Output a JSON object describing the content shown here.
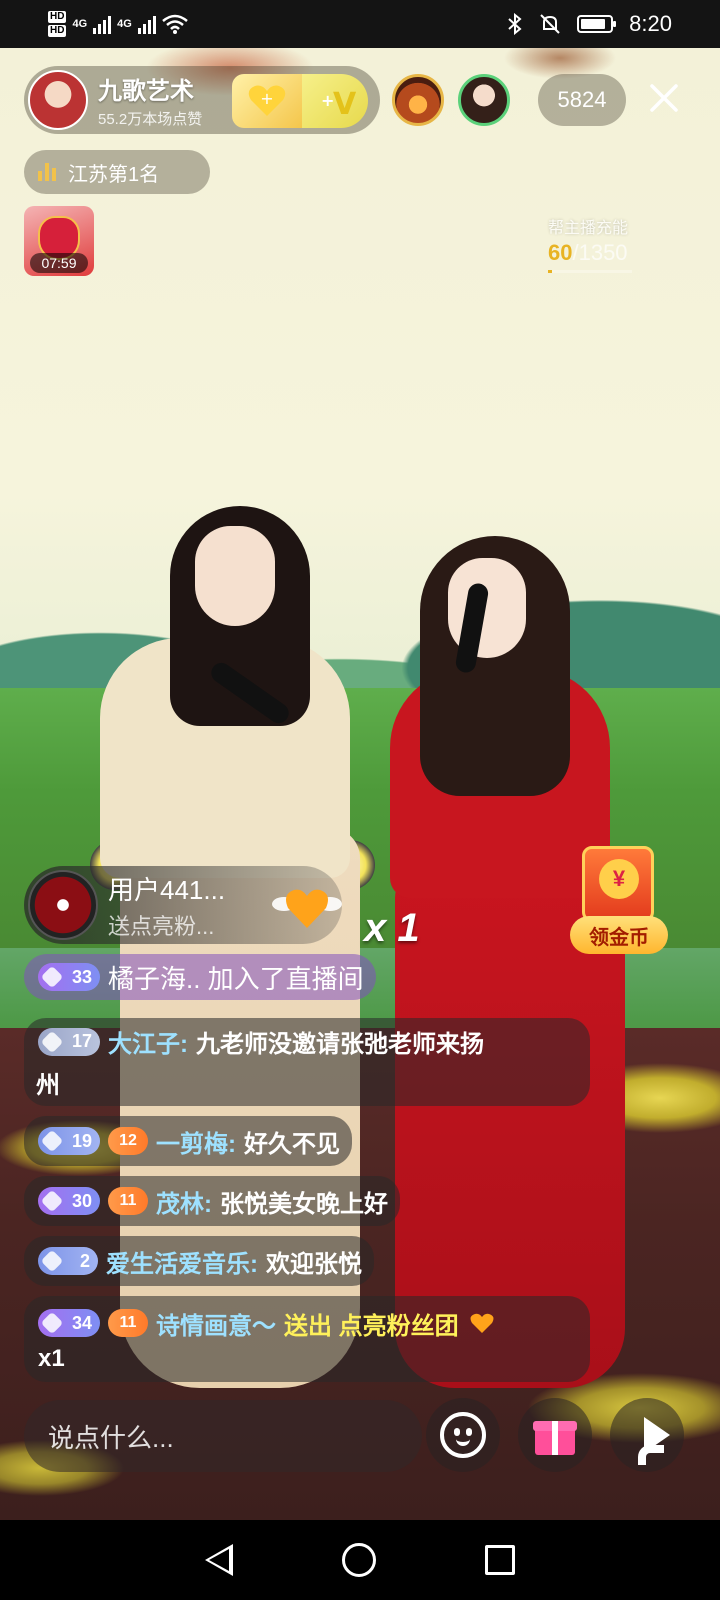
{
  "status_bar": {
    "hd1": "HD",
    "hd2": "HD",
    "net1": "4G",
    "net2": "4G",
    "time": "8:20",
    "battery_percent": 85
  },
  "host": {
    "name": "九歌艺术",
    "likes": "55.2万本场点赞"
  },
  "online_count": "5824",
  "rank": {
    "label": "江苏第1名"
  },
  "timer_gift": {
    "time": "07:59"
  },
  "charge": {
    "label": "帮主播充能",
    "current": "60",
    "total": "/1350",
    "fraction": 0.044
  },
  "gift_notice": {
    "user": "用户441...",
    "text": "送点亮粉...",
    "count": "x 1"
  },
  "coin_button": {
    "label": "领金币",
    "symbol": "¥"
  },
  "chat": {
    "join": {
      "level": "33",
      "text": "橘子海.. 加入了直播间"
    },
    "messages": [
      {
        "level": "17",
        "fan": "",
        "name": "大江子:",
        "msg": "九老师没邀请张弛老师来扬",
        "msg2": "州"
      },
      {
        "level": "19",
        "fan": "12",
        "name": "一剪梅:",
        "msg": "好久不见"
      },
      {
        "level": "30",
        "fan": "11",
        "name": "茂林:",
        "msg": "张悦美女晚上好"
      },
      {
        "level": "2",
        "fan": "",
        "name": "爱生活爱音乐:",
        "msg": "欢迎张悦"
      },
      {
        "level": "34",
        "fan": "11",
        "name": "诗情画意～",
        "action": "送出 点亮粉丝团",
        "msg2": "x1"
      }
    ]
  },
  "input": {
    "placeholder": "说点什么..."
  },
  "colors": {
    "accent_gold": "#e8b323",
    "chat_name": "#9ee1ff",
    "gift_pink": "#ff4f9a"
  }
}
